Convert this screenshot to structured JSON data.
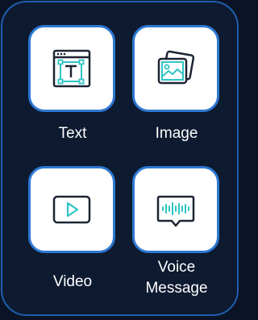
{
  "options": [
    {
      "id": "text",
      "label": "Text",
      "icon": "text-icon"
    },
    {
      "id": "image",
      "label": "Image",
      "icon": "image-icon"
    },
    {
      "id": "video",
      "label": "Video",
      "icon": "video-icon"
    },
    {
      "id": "voice",
      "label_line1": "Voice",
      "label_line2": "Message",
      "icon": "voice-message-icon"
    }
  ],
  "colors": {
    "background": "#0d1a30",
    "border": "#1f5fb0",
    "tile_border": "#2e78d2",
    "icon_dark": "#1d2433",
    "icon_accent": "#2ec4c4"
  }
}
